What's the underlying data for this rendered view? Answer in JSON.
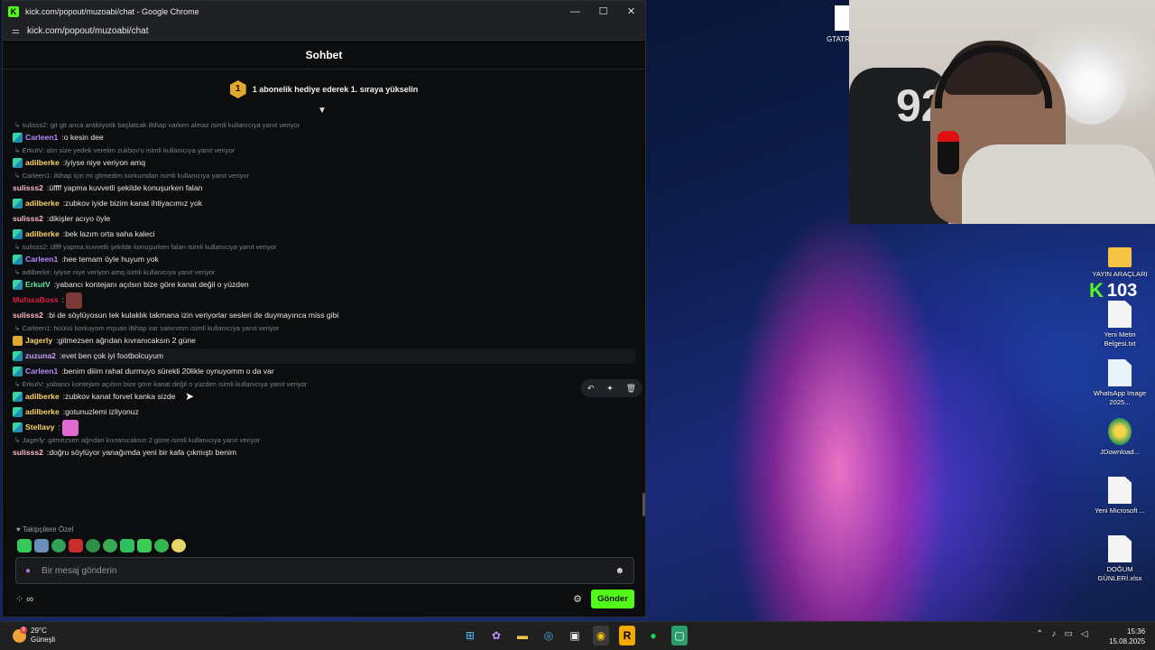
{
  "window": {
    "title": "kick.com/popout/muzoabi/chat - Google Chrome",
    "url": "kick.com/popout/muzoabi/chat",
    "favicon": "K"
  },
  "chat": {
    "header": "Sohbet",
    "gift_badge_number": "1",
    "gift_banner": "1 abonelik hediye ederek 1. sıraya yükselin",
    "messages": [
      {
        "reply": "sulisss2: git git anca antibiyotik başlatcak iltihap varken almaz isimli kullanıcıya yanıt veriyor",
        "user": "Carleen1",
        "color": "#b58cff",
        "text": "o kesin dee"
      },
      {
        "reply": "ErkutV: alın size yedek verelim zukbov'u isimli kullanıcıya yanıt veriyor",
        "user": "adilberke",
        "color": "#ffd36b",
        "text": "iyiyse niye veriyon amq"
      },
      {
        "reply": "Carleen1: iltihap için mi gitmedim korkumdan isimli kullanıcıya yanıt veriyor",
        "user": "sulisss2",
        "color": "#ffb8c8",
        "text": "üffff yapma kuvvetli şekilde konuşurken falan"
      },
      {
        "reply": "",
        "user": "adilberke",
        "color": "#ffd36b",
        "text": "zubkov iyide bizim kanat ihtiyacımız yok"
      },
      {
        "reply": "",
        "user": "sulisss2",
        "color": "#ffb8c8",
        "text": "dikişler acıyo öyle"
      },
      {
        "reply": "",
        "user": "adilberke",
        "color": "#ffd36b",
        "text": "bek lazım orta saha kaleci"
      },
      {
        "reply": "sulisss2: üffff yapma kuvvetli şekilde konuşurken falan isimli kullanıcıya yanıt veriyor",
        "user": "Carleen1",
        "color": "#b58cff",
        "text": "hee temam öyle huyum yok"
      },
      {
        "reply": "adilberke: iyiyse niye veriyon amq isimli kullanıcıya yanıt veriyor",
        "user": "ErkutV",
        "color": "#62e8a6",
        "text": "yabancı kontejanı açılsın bize göre kanat değil o yüzden"
      },
      {
        "reply": "",
        "user": "MufasaBoss",
        "color": "#e0204a",
        "text": ""
      },
      {
        "reply": "",
        "user": "sulisss2",
        "color": "#ffb8c8",
        "text": "bi de söylüyosun tek kulaklık takmana izin veriyorlar sesleri de duymayınca miss gibi"
      },
      {
        "reply": "Carleen1: hüüüü korkuyom mşuan iltihap var sanırımm isimli kullanıcıya yanıt veriyor",
        "user": "Jagerly",
        "color": "#ffd36b",
        "text": "gitmezsen ağrıdan kıvranıcaksın 2 güne"
      },
      {
        "reply": "",
        "user": "zuzuna2",
        "color": "#c79bff",
        "text": "evet ben çok iyi footbolcuyum"
      },
      {
        "reply": "",
        "user": "Carleen1",
        "color": "#b58cff",
        "text": "benim diiim rahat durmuyo sürekli 20likle oynuyomm o da var"
      },
      {
        "reply": "ErkutV: yabancı kontejanı açılsın bize göre kanat değil o yüzden isimli kullanıcıya yanıt veriyor",
        "user": "adilberke",
        "color": "#ffd36b",
        "text": "zubkov kanat forvet kanka sizde"
      },
      {
        "reply": "",
        "user": "adilberke",
        "color": "#ffd36b",
        "text": "gotunuzlemi izliyonuz"
      },
      {
        "reply": "",
        "user": "Stellavy",
        "color": "#ffd36b",
        "text": ""
      },
      {
        "reply": "Jagerly: gitmezsen ağrıdan kıvranıcaksın 2 güne isimli kullanıcıya yanıt veriyor",
        "user": "sulisss2",
        "color": "#ffb8c8",
        "text": "doğru söylüyor yanağımda yeni bir kafa çıkmıştı benim"
      }
    ],
    "followers_label": "Takipçilere Özel",
    "input_placeholder": "Bir mesaj gönderin",
    "send_label": "Gönder",
    "bottom_tools": "⁘ ∞"
  },
  "desktop": {
    "top_label": "GTATR",
    "viewer_count": "103",
    "icons": [
      {
        "label": "YAYIN ARAÇLARI"
      },
      {
        "label": "Yeni Metin Belgesi.txt"
      },
      {
        "label": "WhatsApp Image 2025..."
      },
      {
        "label": "JDownload..."
      },
      {
        "label": "Yeni Microsoft ..."
      },
      {
        "label": "DOĞUM GÜNLERİ.xlsx"
      }
    ]
  },
  "taskbar": {
    "weather_temp": "29°C",
    "weather_desc": "Güneşli",
    "weather_badge": "9",
    "time": "15:36",
    "date": "15.08.2025"
  },
  "colors": {
    "kick_green": "#53fc18",
    "chat_bg": "#0b0d0e"
  }
}
